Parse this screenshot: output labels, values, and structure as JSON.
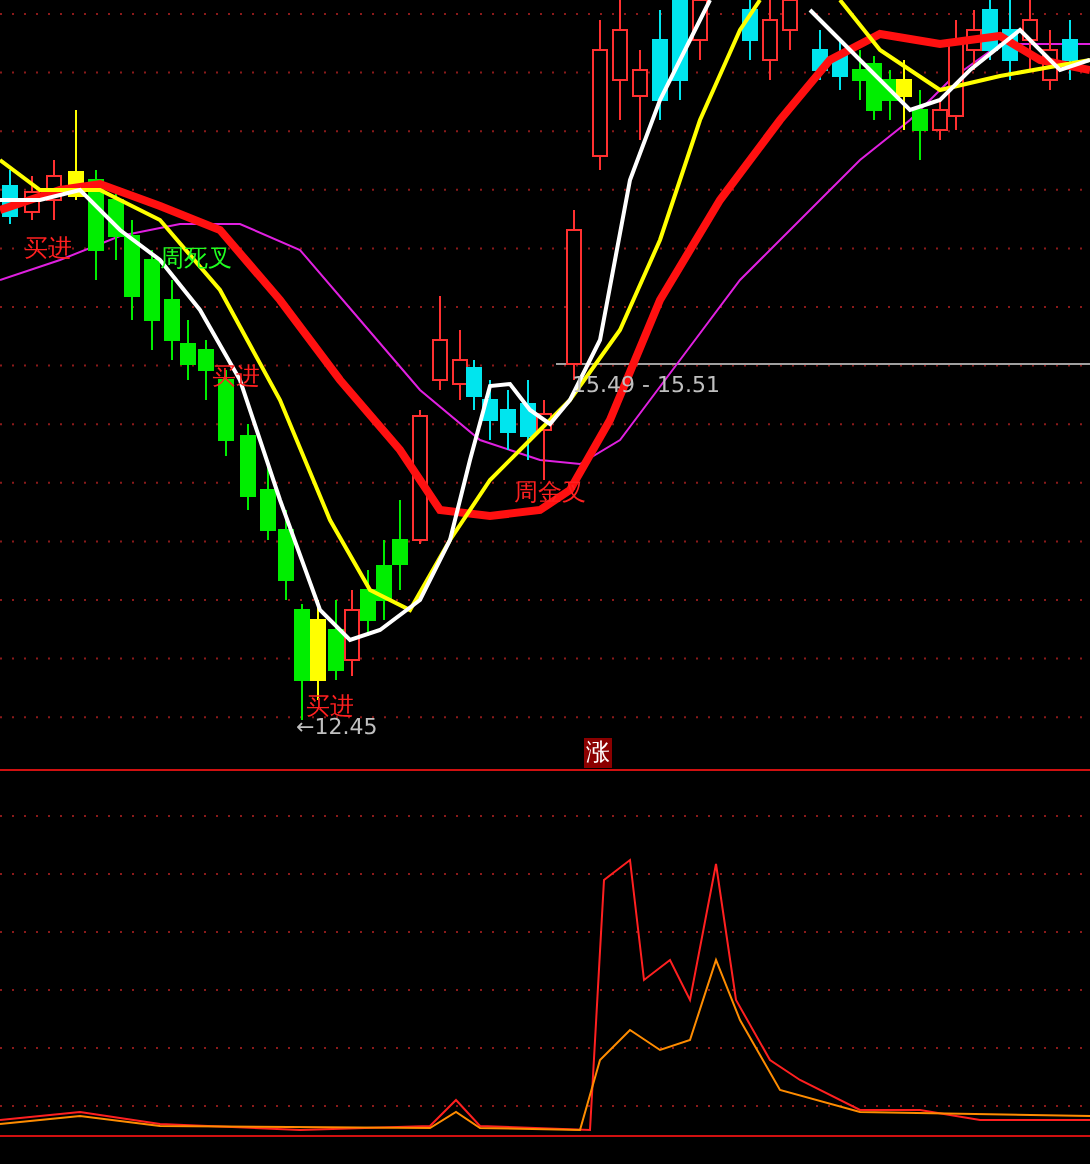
{
  "main_chart": {
    "signals": [
      {
        "text": "买进",
        "color": "#ff2020"
      },
      {
        "text": "周死叉",
        "color": "#20ff20"
      },
      {
        "text": "买进",
        "color": "#ff2020"
      },
      {
        "text": "周金叉",
        "color": "#ff2020"
      },
      {
        "text": "买进",
        "color": "#ff2020"
      }
    ],
    "price_labels": [
      {
        "text": "15.49 - 15.51"
      },
      {
        "text": "←12.45"
      }
    ]
  },
  "divider_badge": "涨"
}
